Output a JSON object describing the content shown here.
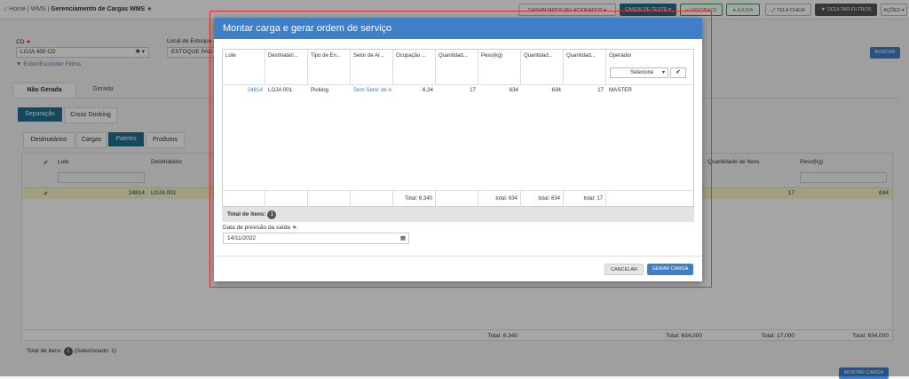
{
  "breadcrumb": {
    "home": "Home",
    "module": "WMS",
    "page": "Gerenciamento de Cargas WMS"
  },
  "toolbar": {
    "dashboards": "DASHBOARDS RELACIONADOS",
    "casos": "CASOS DE TESTE",
    "feedback": "FEEDBACK",
    "ajuda": "AJUDA",
    "tela_cheia": "TELA CHEIA",
    "ocultar": "OCULTAR FILTROS",
    "acoes": "AÇÕES"
  },
  "filters": {
    "cd_label": "CD",
    "cd_value": "LOJA 400 CD",
    "local_label": "Local de Estoque",
    "local_value": "ESTOQUE PAD",
    "toggle": "Exibir/Esconder Filtros",
    "buscar": "BUSCAR"
  },
  "tabs": {
    "nao_gerada": "Não Gerada",
    "gerada": "Gerada",
    "separacao": "Separação",
    "cross": "Cross Docking",
    "destinatarios": "Destinatários",
    "cargas": "Cargas",
    "paletes": "Paletes",
    "produtos": "Produtos"
  },
  "bg_table": {
    "col_lote": "Lote",
    "col_dest": "Destinatário",
    "col_qtd": "Quantidade de Itens",
    "col_peso": "Peso(kg)",
    "row_lote": "24814",
    "row_dest": "LOJA 001",
    "row_qtd": "17",
    "row_peso": "634",
    "f_ocup": "Total: 6,340",
    "f_peso1": "Total: 634,000",
    "f_qtd": "Total: 17,000",
    "f_peso2": "Total: 634,000",
    "total_label": "Total de itens:",
    "total_count": "1",
    "selected": "(Selecionado: 1)",
    "montar": "MONTAR CARGA"
  },
  "modal": {
    "title": "Montar carga e gerar ordem de serviço",
    "headers": [
      "Lote",
      "Destinatári...",
      "Tipo de En...",
      "Setor de Ar...",
      "Ocupação ...",
      "Quantidad...",
      "Peso(kg)",
      "Quantidad...",
      "Quantidad...",
      "Operador"
    ],
    "operador_select": "Selecione",
    "row": [
      "24814",
      "LOJA 001",
      "Picking",
      "Sem Setor de A",
      "6,34",
      "17",
      "634",
      "634",
      "17",
      "MASTER"
    ],
    "footer": [
      "Total: 6,340",
      "total: 634",
      "total: 634",
      "total: 17"
    ],
    "total_label": "Total de itens:",
    "total_count": "1",
    "date_label": "Data de previsão da saída",
    "date_value": "14/11/2022",
    "cancel": "CANCELAR",
    "gerar": "GERAR CARGA"
  },
  "colors": {
    "primary": "#3f7fc8",
    "teal": "#1f6f8b",
    "green": "#3a9a4a",
    "required": "#e03030"
  }
}
